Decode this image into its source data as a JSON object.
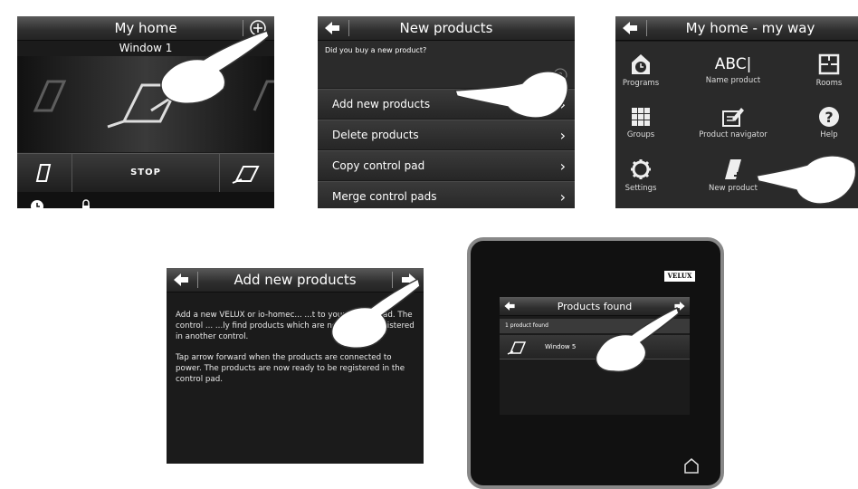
{
  "screen1": {
    "title": "My home",
    "window_label": "Window 1",
    "stop_label": "STOP",
    "plus_icon": "plus-circle-icon"
  },
  "screen2": {
    "title": "New products",
    "prompt": "Did you buy a new product?",
    "items": [
      "Add new products",
      "Delete products",
      "Copy control pad",
      "Merge control pads"
    ]
  },
  "screen3": {
    "title": "My home - my way",
    "tiles": [
      {
        "label": "Programs",
        "icon": "clock-house-icon"
      },
      {
        "label": "Name product",
        "icon": "abc-text-icon",
        "icon_text": "ABC|"
      },
      {
        "label": "Rooms",
        "icon": "floorplan-icon"
      },
      {
        "label": "Groups",
        "icon": "grid-icon"
      },
      {
        "label": "Product navigator",
        "icon": "edit-panel-icon"
      },
      {
        "label": "Help",
        "icon": "help-icon"
      },
      {
        "label": "Settings",
        "icon": "gear-icon"
      },
      {
        "label": "New product",
        "icon": "new-product-icon"
      }
    ]
  },
  "screen4": {
    "title": "Add new products",
    "paragraph1": "Add a new VELUX or io-homec... ...t to your control pad. The control ... ...ly find products which are not already registered in another control.",
    "paragraph2": "Tap arrow forward when the products are connected to power. The products are now ready to be registered in the control pad."
  },
  "device": {
    "brand": "VELUX",
    "screen": {
      "title": "Products found",
      "found_text": "1 product found",
      "product_label": "Window 5"
    },
    "home_icon": "home-icon"
  }
}
